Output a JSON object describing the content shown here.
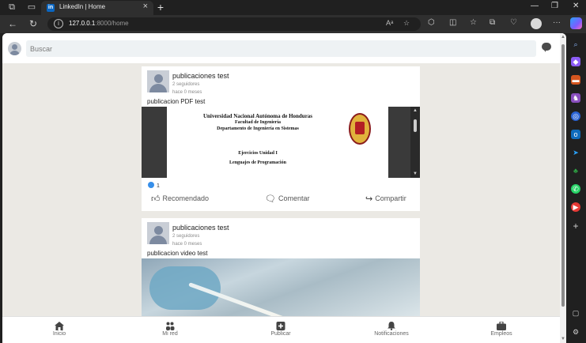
{
  "browser": {
    "tab_title": "LinkedIn | Home",
    "tab_favicon": "in",
    "url_host": "127.0.0.1",
    "url_path": ":8000/home"
  },
  "search": {
    "placeholder": "Buscar"
  },
  "posts": [
    {
      "author": "publicaciones test",
      "followers": "2 seguidores",
      "time": "hace 0 meses",
      "text": "publicacion PDF test",
      "pdf": {
        "line1": "Universidad Nacional Autónoma de Honduras",
        "line2": "Facultad de Ingeniería",
        "line3": "Departamento de Ingeniería en Sistemas",
        "line4": "Ejercicios Unidad I",
        "line5": "Lenguajes de Programación"
      },
      "reaction_count": "1",
      "actions": {
        "like": "Recomendado",
        "comment": "Comentar",
        "share": "Compartir"
      }
    },
    {
      "author": "publicaciones test",
      "followers": "2 seguidores",
      "time": "hace 0 meses",
      "text": "publicacion video test"
    }
  ],
  "bottom_nav": {
    "home": "Inicio",
    "network": "Mi red",
    "post": "Publicar",
    "notifications": "Notificaciones",
    "jobs": "Empleos"
  },
  "colors": {
    "accent": "#0a66c2",
    "like": "#378fe9",
    "page_bg": "#ebe9e4"
  }
}
